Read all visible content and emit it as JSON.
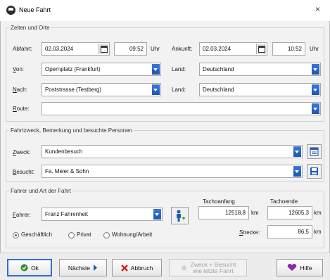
{
  "window": {
    "title": "Neue Fahrt",
    "close_glyph": "×"
  },
  "section_times": {
    "legend": "Zeiten und Orte",
    "departure_label": "Abfahrt:",
    "departure_date": "02.03.2024",
    "departure_time": "09:52",
    "departure_time_unit": "Uhr",
    "arrival_label": "Ankunft:",
    "arrival_date": "02.03.2024",
    "arrival_time": "10:52",
    "arrival_time_unit": "Uhr",
    "from_label": "Von:",
    "from_value": "Opernplatz (Frankfurt)",
    "from_country_label": "Land:",
    "from_country_value": "Deutschland",
    "to_label": "Nach:",
    "to_value": "Poststrasse (Testberg)",
    "to_country_label": "Land:",
    "to_country_value": "Deutschland",
    "route_label": "Route:",
    "route_value": ""
  },
  "section_purpose": {
    "legend": "Fahrtzweck, Bemerkung und besuchte Personen",
    "purpose_label": "Zweck:",
    "purpose_value": "Kundenbesuch",
    "visited_label": "Besucht:",
    "visited_value": "Fa. Meier & Sohn"
  },
  "section_driver": {
    "legend": "Fahrer und Art der Fahrt",
    "driver_label": "Fahrer:",
    "driver_value": "Franz Fahrenheit",
    "tacho_start_label": "Tachoanfang",
    "tacho_start_value": "12518,8",
    "tacho_start_unit": "km",
    "tacho_end_label": "Tachoende",
    "tacho_end_value": "12605,3",
    "tacho_end_unit": "km",
    "distance_label": "Strecke:",
    "distance_value": "86,5",
    "distance_unit": "km",
    "trip_types": [
      "Geschäftlich",
      "Privat",
      "Wohnung/Arbeit"
    ],
    "selected_trip_type": "Geschäftlich"
  },
  "buttons": {
    "ok": "Ok",
    "next": "Nächste",
    "cancel": "Abbruch",
    "purpose_line1": "Zweck + Besucht",
    "purpose_line2": "wie letzte Fahrt",
    "help": "Hilfe"
  },
  "colors": {
    "accent": "#1d56b3",
    "window_bg": "#f2f2f2"
  },
  "icons": [
    "calendar-icon",
    "dropdown-arrow-icon",
    "person-add-icon",
    "list-icon",
    "save-icon",
    "check-icon",
    "arrow-right-icon",
    "cancel-x-icon",
    "star-icon",
    "help-icon"
  ]
}
